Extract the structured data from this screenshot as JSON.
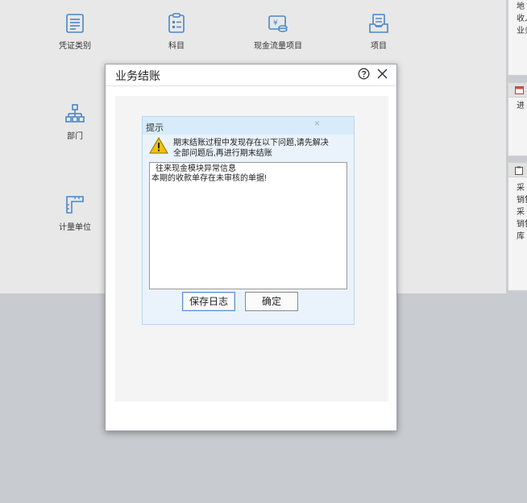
{
  "tiles": {
    "voucher_type": "凭证类别",
    "subject": "科目",
    "cash_flow_item": "现金流量项目",
    "project": "项目",
    "department": "部门",
    "unit": "计量单位"
  },
  "right_panel": {
    "top_lines": [
      "地",
      "收入",
      "业务"
    ],
    "mid_lines": [
      "进"
    ],
    "bottom_lines": [
      "采",
      "销售",
      "采",
      "销售",
      "库"
    ]
  },
  "dialog": {
    "title": "业务结账",
    "help_icon": "help-icon",
    "close_icon": "close-icon"
  },
  "prompt": {
    "title": "提示",
    "message": "期末结账过程中发现存在以下问题,请先解决全部问题后,再进行期末结账",
    "log_lines": [
      "往来现金模块异常信息",
      "本期的收款单存在未审核的单据!"
    ],
    "save_log_label": "保存日志",
    "ok_label": "确定"
  },
  "colors": {
    "accent": "#4a86c8",
    "warning": "#f2c200"
  }
}
